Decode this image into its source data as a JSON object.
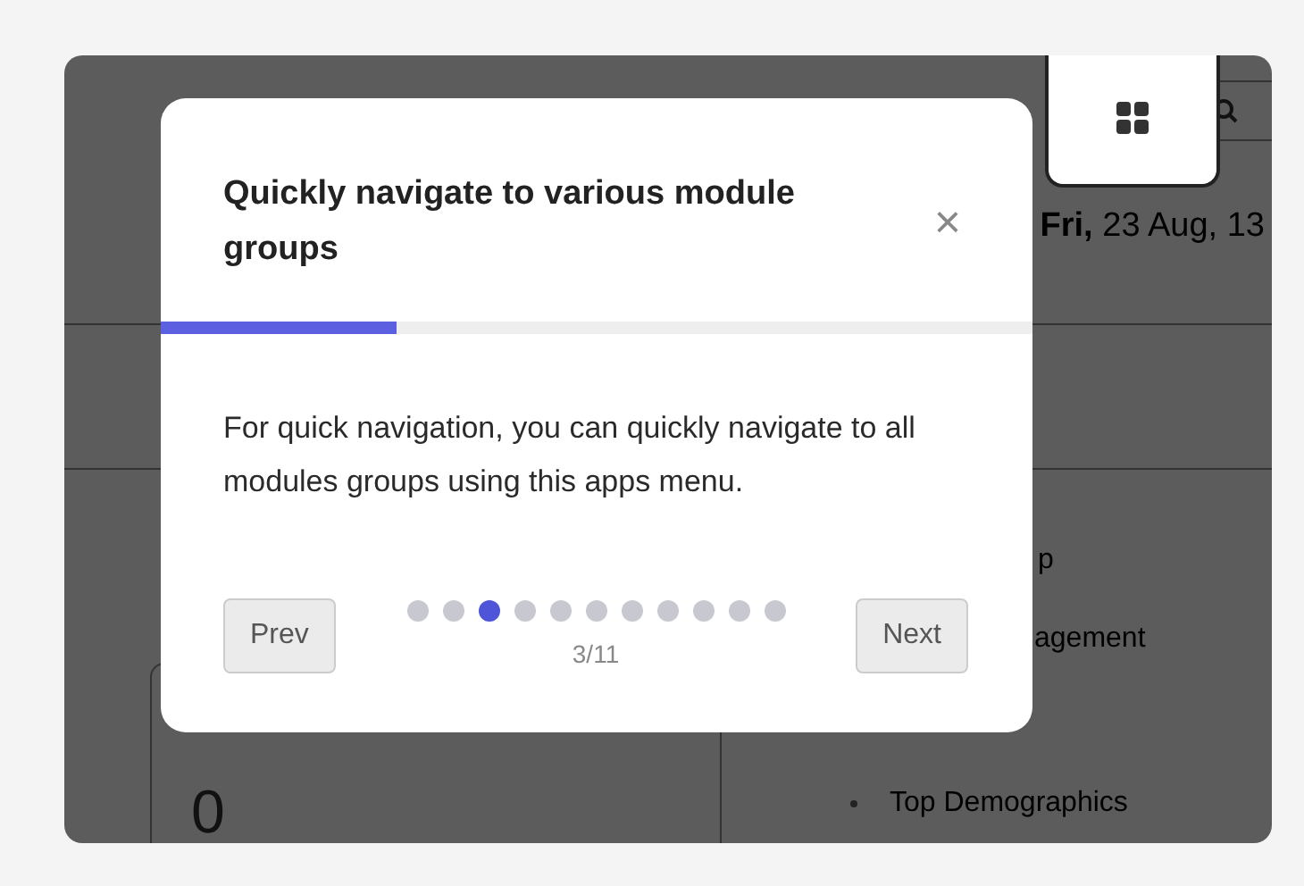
{
  "dashboard": {
    "date_day": "Fri,",
    "date_rest": "23 Aug, 13",
    "menu_fragments": [
      "p",
      "agement"
    ],
    "list_items": [
      "Top Demographics"
    ],
    "stat_value": "0"
  },
  "tour": {
    "title": "Quickly navigate to various module groups",
    "close": "×",
    "progress": {
      "level": 0.27
    },
    "body": "For quick navigation, you can quickly navigate to all modules groups using this apps menu.",
    "prev": "Prev",
    "next": "Next",
    "counter": "3/11",
    "dots": [
      {
        "selected": false
      },
      {
        "selected": false
      },
      {
        "selected": true
      },
      {
        "selected": false
      },
      {
        "selected": false
      },
      {
        "selected": false
      },
      {
        "selected": false
      },
      {
        "selected": false
      },
      {
        "selected": false
      },
      {
        "selected": false
      },
      {
        "selected": false
      }
    ]
  }
}
